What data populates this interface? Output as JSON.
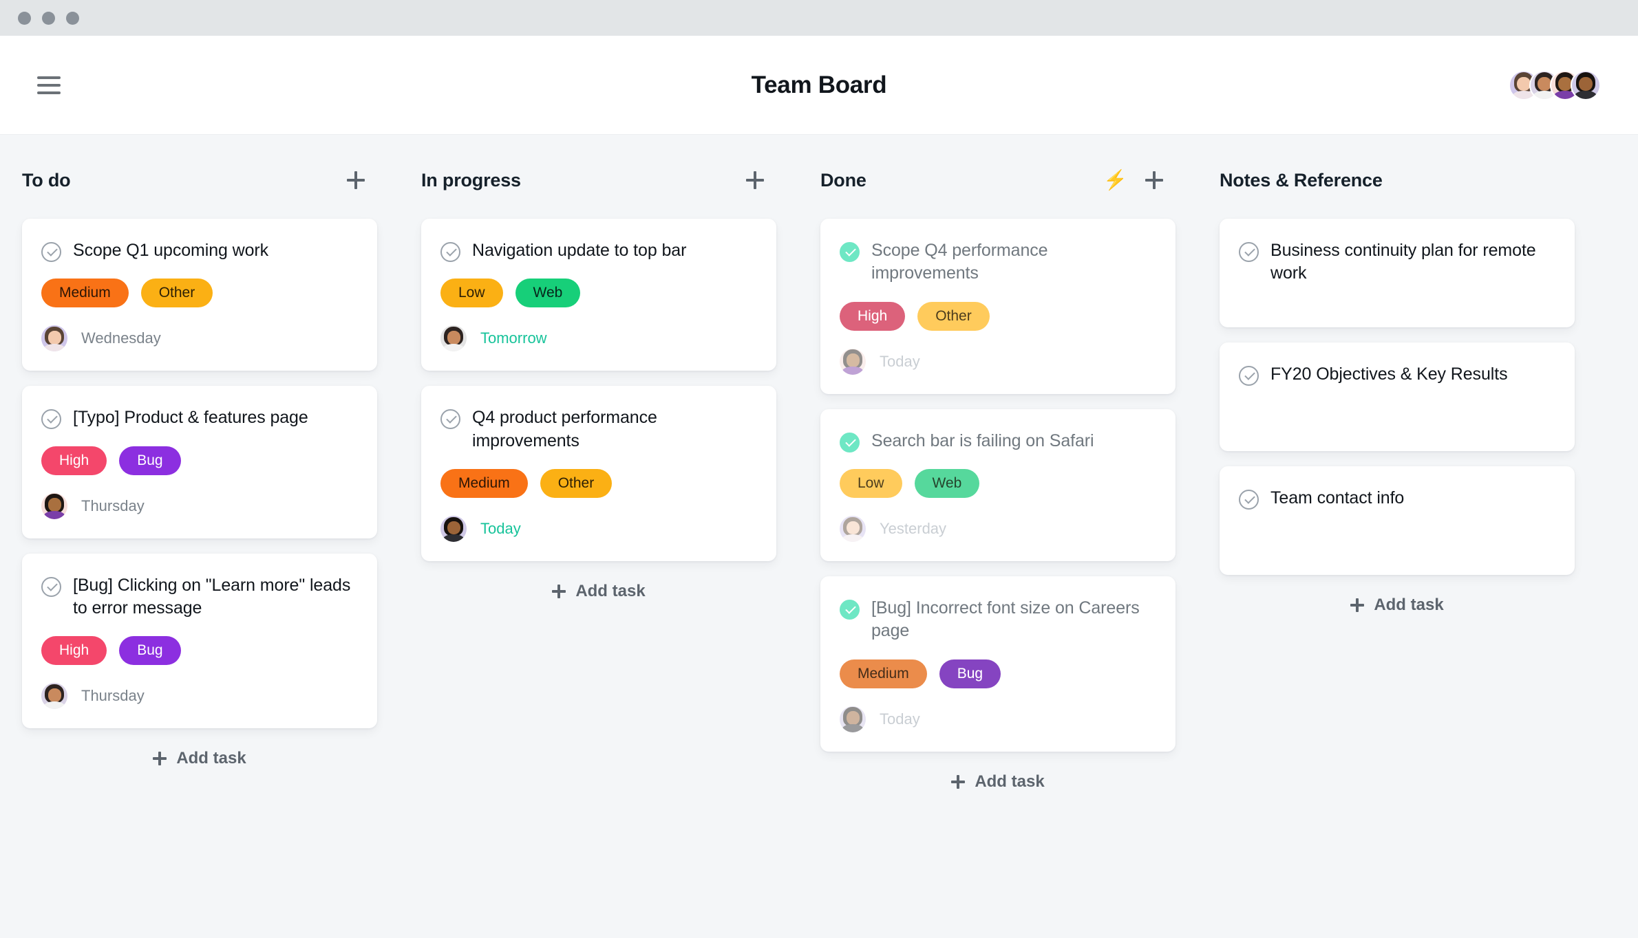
{
  "window": {
    "dots": [
      "dot-1",
      "dot-2",
      "dot-3"
    ]
  },
  "header": {
    "menu_icon": "hamburger-icon",
    "title": "Team Board",
    "members": [
      {
        "name": "member-1",
        "hair": "#5a4435",
        "skin": "#f3c9ad",
        "body": "#efe4e9",
        "bg": "#cfc6ea"
      },
      {
        "name": "member-2",
        "hair": "#2d2320",
        "skin": "#c98a5e",
        "body": "#f2f2f2",
        "bg": "#d9d2e6"
      },
      {
        "name": "member-3",
        "hair": "#1e1713",
        "skin": "#a9703f",
        "body": "#7a3ea8",
        "bg": "#f6ddd9"
      },
      {
        "name": "member-4",
        "hair": "#17120f",
        "skin": "#9c6438",
        "body": "#2e2e33",
        "bg": "#cfc8e6"
      }
    ]
  },
  "board": {
    "add_task_label": "Add task",
    "columns": [
      {
        "id": "todo",
        "title": "To do",
        "has_bolt": false,
        "add_icon": "plus-icon",
        "show_add_task": true,
        "cards": [
          {
            "title": "Scope Q1 upcoming work",
            "done": false,
            "wrap": false,
            "tags": [
              {
                "label": "Medium",
                "bg": "#f97216",
                "fg": "#2c1505"
              },
              {
                "label": "Other",
                "bg": "#fbb014",
                "fg": "#2c1f05"
              }
            ],
            "assignee": {
              "name": "member-1",
              "hair": "#5a4435",
              "skin": "#f3c9ad",
              "body": "#efe4e9",
              "bg": "#cfc6ea"
            },
            "due": "Wednesday",
            "due_soon": false
          },
          {
            "title": "[Typo] Product & features page",
            "done": false,
            "wrap": false,
            "tags": [
              {
                "label": "High",
                "bg": "#f4476b",
                "fg": "#ffffff"
              },
              {
                "label": "Bug",
                "bg": "#8c2fe0",
                "fg": "#ffffff"
              }
            ],
            "assignee": {
              "name": "member-3",
              "hair": "#1e1713",
              "skin": "#a9703f",
              "body": "#7a3ea8",
              "bg": "#f6ddd9"
            },
            "due": "Thursday",
            "due_soon": false
          },
          {
            "title": "[Bug] Clicking on \"Learn more\" leads to error message",
            "done": false,
            "wrap": true,
            "tags": [
              {
                "label": "High",
                "bg": "#f4476b",
                "fg": "#ffffff"
              },
              {
                "label": "Bug",
                "bg": "#8c2fe0",
                "fg": "#ffffff"
              }
            ],
            "assignee": {
              "name": "member-2",
              "hair": "#2d2320",
              "skin": "#c98a5e",
              "body": "#f2f2f2",
              "bg": "#d9d2e6"
            },
            "due": "Thursday",
            "due_soon": false
          }
        ]
      },
      {
        "id": "in-progress",
        "title": "In progress",
        "has_bolt": false,
        "add_icon": "plus-icon",
        "show_add_task": true,
        "cards": [
          {
            "title": "Navigation update to top bar",
            "done": false,
            "wrap": false,
            "tags": [
              {
                "label": "Low",
                "bg": "#fbb014",
                "fg": "#2c1f05"
              },
              {
                "label": "Web",
                "bg": "#17cf79",
                "fg": "#06251a"
              }
            ],
            "assignee": {
              "name": "member-2",
              "hair": "#2d2320",
              "skin": "#c98a5e",
              "body": "#f2f2f2",
              "bg": "#e3e3e3"
            },
            "due": "Tomorrow",
            "due_soon": true
          },
          {
            "title": "Q4 product performance improvements",
            "done": false,
            "wrap": true,
            "tags": [
              {
                "label": "Medium",
                "bg": "#f97216",
                "fg": "#2c1505"
              },
              {
                "label": "Other",
                "bg": "#fbb014",
                "fg": "#2c1f05"
              }
            ],
            "assignee": {
              "name": "member-4",
              "hair": "#17120f",
              "skin": "#9c6438",
              "body": "#2e2e33",
              "bg": "#cfc8e6"
            },
            "due": "Today",
            "due_soon": true
          }
        ]
      },
      {
        "id": "done",
        "title": "Done",
        "has_bolt": true,
        "bolt_icon": "lightning-bolt-icon",
        "add_icon": "plus-icon",
        "show_add_task": true,
        "cards": [
          {
            "title": "Scope Q4 performance improvements",
            "done": true,
            "wrap": true,
            "tags": [
              {
                "label": "High",
                "bg": "#f4476b",
                "fg": "#ffffff"
              },
              {
                "label": "Other",
                "bg": "#fbb014",
                "fg": "#4a3508"
              }
            ],
            "assignee": {
              "name": "member-3",
              "hair": "#1e1713",
              "skin": "#a9703f",
              "body": "#7a3ea8",
              "bg": "#f6ddd9"
            },
            "due": "Today",
            "due_soon": false
          },
          {
            "title": "Search bar is failing on Safari",
            "done": true,
            "wrap": false,
            "tags": [
              {
                "label": "Low",
                "bg": "#fbb014",
                "fg": "#4a3508"
              },
              {
                "label": "Web",
                "bg": "#17cf79",
                "fg": "#14401f"
              }
            ],
            "assignee": {
              "name": "member-1",
              "hair": "#5a4435",
              "skin": "#f3c9ad",
              "body": "#efe4e9",
              "bg": "#cfc6ea"
            },
            "due": "Yesterday",
            "due_soon": false
          },
          {
            "title": "[Bug] Incorrect font size on Careers page",
            "done": true,
            "wrap": true,
            "tags": [
              {
                "label": "Medium",
                "bg": "#f97216",
                "fg": "#46250a"
              },
              {
                "label": "Bug",
                "bg": "#8c2fe0",
                "fg": "#ffffff"
              }
            ],
            "assignee": {
              "name": "member-4",
              "hair": "#17120f",
              "skin": "#9c6438",
              "body": "#2e2e33",
              "bg": "#cfc8e6"
            },
            "due": "Today",
            "due_soon": false
          }
        ]
      },
      {
        "id": "notes",
        "title": "Notes & Reference",
        "has_bolt": false,
        "add_icon": null,
        "show_add_task": true,
        "cards": [
          {
            "title": "Business continuity plan for remote work",
            "done": false,
            "wrap": true,
            "note": true,
            "tags": [],
            "assignee": null,
            "due": null,
            "due_soon": false
          },
          {
            "title": "FY20 Objectives & Key Results",
            "done": false,
            "wrap": false,
            "note": true,
            "tags": [],
            "assignee": null,
            "due": null,
            "due_soon": false
          },
          {
            "title": "Team contact info",
            "done": false,
            "wrap": false,
            "note": true,
            "tags": [],
            "assignee": null,
            "due": null,
            "due_soon": false
          }
        ]
      }
    ]
  }
}
